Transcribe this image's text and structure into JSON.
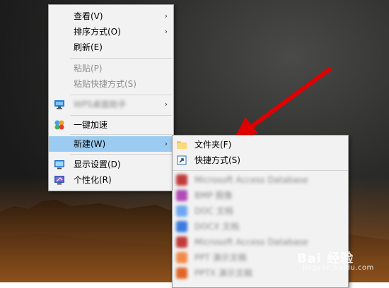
{
  "main_menu": {
    "items": [
      {
        "label": "查看(V)",
        "icon": "",
        "has_submenu": true,
        "disabled": false
      },
      {
        "label": "排序方式(O)",
        "icon": "",
        "has_submenu": true,
        "disabled": false
      },
      {
        "label": "刷新(E)",
        "icon": "",
        "has_submenu": false,
        "disabled": false
      },
      {
        "label": "粘贴(P)",
        "icon": "",
        "has_submenu": false,
        "disabled": true
      },
      {
        "label": "粘贴快捷方式(S)",
        "icon": "",
        "has_submenu": false,
        "disabled": true
      },
      {
        "label": "WPS桌面助手",
        "icon": "monitor-icon",
        "has_submenu": true,
        "disabled": false
      },
      {
        "label": "一键加速",
        "icon": "speedup-icon",
        "has_submenu": false,
        "disabled": false
      },
      {
        "label": "新建(W)",
        "icon": "",
        "has_submenu": true,
        "disabled": false,
        "highlighted": true
      },
      {
        "label": "显示设置(D)",
        "icon": "display-settings-icon",
        "has_submenu": false,
        "disabled": false
      },
      {
        "label": "个性化(R)",
        "icon": "personalize-icon",
        "has_submenu": false,
        "disabled": false
      }
    ]
  },
  "new_submenu": {
    "items": [
      {
        "label": "文件夹(F)",
        "icon": "folder-icon"
      },
      {
        "label": "快捷方式(S)",
        "icon": "shortcut-icon"
      },
      {
        "label": "Microsoft Access Database",
        "icon": "access-icon",
        "blurred": true
      },
      {
        "label": "BMP 图像",
        "icon": "bmp-icon",
        "blurred": true
      },
      {
        "label": "DOC 文档",
        "icon": "doc-icon",
        "blurred": true
      },
      {
        "label": "DOCX 文档",
        "icon": "docx-icon",
        "blurred": true
      },
      {
        "label": "Microsoft Access Database",
        "icon": "access-icon",
        "blurred": true
      },
      {
        "label": "PPT 演示文稿",
        "icon": "ppt-icon",
        "blurred": true
      },
      {
        "label": "PPTX 演示文稿",
        "icon": "pptx-icon",
        "blurred": true
      }
    ]
  },
  "watermark": {
    "main": "Bai 经验",
    "sub": "jingyan.baidu.com"
  },
  "colors": {
    "highlight": "#9bcbf0",
    "menu_bg": "#f2f2f2",
    "arrow": "#e00000",
    "folder": "#f6c75a"
  }
}
